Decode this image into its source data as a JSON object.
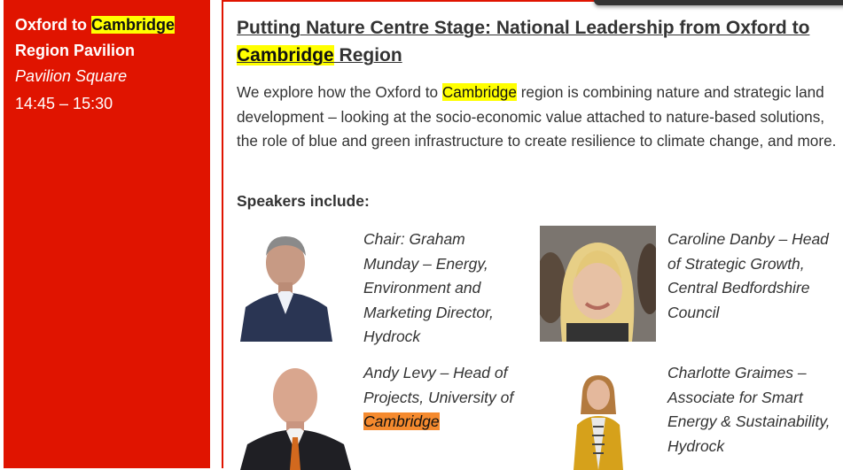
{
  "sidebar": {
    "pavilion_pre": "Oxford to ",
    "pavilion_hl": "Cambridge",
    "pavilion_post": "Region Pavilion",
    "location": "Pavilion Square",
    "time": "14:45 – 15:30"
  },
  "event": {
    "title_pre": "Putting Nature Centre Stage: National Leadership from Oxford to",
    "title_hl": "Cambridge",
    "title_post": " Region",
    "desc_pre": "We explore how the Oxford to ",
    "desc_hl": "Cambridge",
    "desc_post": " region is combining nature and strategic land development – looking at the socio-economic value attached to nature-based solutions, the role of blue and green infrastructure to create resilience to climate change, and more.",
    "speakers_label": "Speakers include:"
  },
  "speakers": [
    {
      "text": "Chair: Graham Munday – Energy, Environment and Marketing Director, Hydrock"
    },
    {
      "text": "Caroline Danby – Head of Strategic Growth, Central Bedfordshire Council"
    },
    {
      "text_pre": "Andy Levy – Head of Projects, University of ",
      "text_hl": "Cambridge"
    },
    {
      "text": "Charlotte Graimes – Associate for Smart Energy & Sustainability, Hydrock"
    }
  ],
  "colors": {
    "accent_red": "#e01400",
    "highlight_yellow": "#ffff00",
    "highlight_orange": "#f58a2e"
  }
}
